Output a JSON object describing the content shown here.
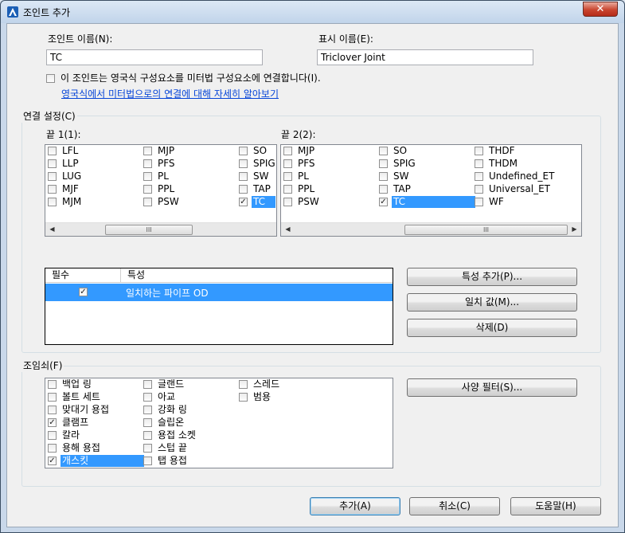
{
  "window": {
    "title": "조인트 추가",
    "close": "✕"
  },
  "fields": {
    "joint_name_label": "조인트 이름(N):",
    "joint_name_value": "TC",
    "display_name_label": "표시 이름(E):",
    "display_name_value": "Triclover Joint",
    "link_checkbox_label": "이 조인트는 영국식 구성요소를 미터법 구성요소에 연결합니다(I).",
    "learn_more_link": "영국식에서 미터법으로의 연결에 대해 자세히 알아보기"
  },
  "connection": {
    "group_title": "연결 설정(C)",
    "end1_label": "끝 1(1):",
    "end2_label": "끝 2(2):",
    "end1_columns": [
      [
        {
          "label": "LFL",
          "checked": false
        },
        {
          "label": "LLP",
          "checked": false
        },
        {
          "label": "LUG",
          "checked": false
        },
        {
          "label": "MJF",
          "checked": false
        },
        {
          "label": "MJM",
          "checked": false
        }
      ],
      [
        {
          "label": "MJP",
          "checked": false
        },
        {
          "label": "PFS",
          "checked": false
        },
        {
          "label": "PL",
          "checked": false
        },
        {
          "label": "PPL",
          "checked": false
        },
        {
          "label": "PSW",
          "checked": false
        }
      ],
      [
        {
          "label": "SO",
          "checked": false
        },
        {
          "label": "SPIG",
          "checked": false
        },
        {
          "label": "SW",
          "checked": false
        },
        {
          "label": "TAP",
          "checked": false
        },
        {
          "label": "TC",
          "checked": true,
          "selected": true
        }
      ]
    ],
    "end2_columns": [
      [
        {
          "label": "MJP",
          "checked": false
        },
        {
          "label": "PFS",
          "checked": false
        },
        {
          "label": "PL",
          "checked": false
        },
        {
          "label": "PPL",
          "checked": false
        },
        {
          "label": "PSW",
          "checked": false
        }
      ],
      [
        {
          "label": "SO",
          "checked": false
        },
        {
          "label": "SPIG",
          "checked": false
        },
        {
          "label": "SW",
          "checked": false
        },
        {
          "label": "TAP",
          "checked": false
        },
        {
          "label": "TC",
          "checked": true,
          "selected": true
        }
      ],
      [
        {
          "label": "THDF",
          "checked": false
        },
        {
          "label": "THDM",
          "checked": false
        },
        {
          "label": "Undefined_ET",
          "checked": false
        },
        {
          "label": "Universal_ET",
          "checked": false
        },
        {
          "label": "WF",
          "checked": false
        }
      ]
    ],
    "scroll_left": "◀",
    "scroll_right": "▶",
    "scroll_grip": "III",
    "table": {
      "col_required": "필수",
      "col_property": "특성",
      "rows": [
        {
          "required": true,
          "property": "일치하는 파이프 OD"
        }
      ]
    },
    "add_property_button": "특성 추가(P)...",
    "match_value_button": "일치 값(M)...",
    "delete_button": "삭제(D)"
  },
  "fasteners": {
    "group_title": "조임쇠(F)",
    "columns": [
      [
        {
          "label": "백업 링",
          "checked": false
        },
        {
          "label": "볼트 세트",
          "checked": false
        },
        {
          "label": "맞대기 용접",
          "checked": false
        },
        {
          "label": "클램프",
          "checked": true
        },
        {
          "label": "칼라",
          "checked": false
        },
        {
          "label": "용해 용접",
          "checked": false
        },
        {
          "label": "개스킷",
          "checked": true,
          "selected": true
        }
      ],
      [
        {
          "label": "글랜드",
          "checked": false
        },
        {
          "label": "아교",
          "checked": false
        },
        {
          "label": "강화 링",
          "checked": false
        },
        {
          "label": "슬립온",
          "checked": false
        },
        {
          "label": "용접 소켓",
          "checked": false
        },
        {
          "label": "스텁 끝",
          "checked": false
        },
        {
          "label": "탭 용접",
          "checked": false
        }
      ],
      [
        {
          "label": "스레드",
          "checked": false
        },
        {
          "label": "범용",
          "checked": false
        }
      ]
    ],
    "spec_filter_button": "사양 필터(S)..."
  },
  "footer": {
    "add_button": "추가(A)",
    "cancel_button": "취소(C)",
    "help_button": "도움말(H)"
  },
  "checkmark": "✓"
}
